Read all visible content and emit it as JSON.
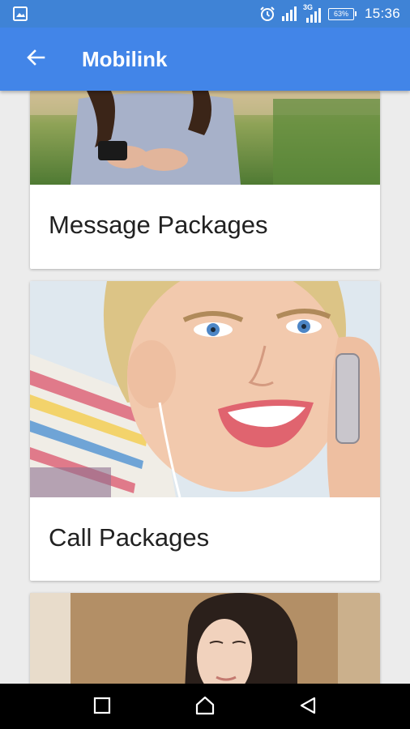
{
  "status_bar": {
    "left_icon": "image-notification-icon",
    "alarm_icon": "alarm-clock-icon",
    "signal_icon": "cell-signal-icon",
    "network_label": "3G",
    "battery": "63%",
    "time": "15:36"
  },
  "app_bar": {
    "back_icon": "arrow-left-icon",
    "title": "Mobilink",
    "color": "#4285e8"
  },
  "cards": [
    {
      "title": "Message Packages",
      "image": "woman-texting-on-phone-photo"
    },
    {
      "title": "Call Packages",
      "image": "smiling-woman-on-phone-photo"
    },
    {
      "title": "",
      "image": "woman-with-phone-photo"
    }
  ],
  "nav_bar": {
    "recents_icon": "square-recents-icon",
    "home_icon": "home-icon",
    "back_icon": "triangle-back-icon"
  },
  "colors": {
    "status_bar": "#3f83d6",
    "app_bar": "#4285e8",
    "background": "#ececec",
    "card": "#ffffff",
    "text": "#212121"
  }
}
